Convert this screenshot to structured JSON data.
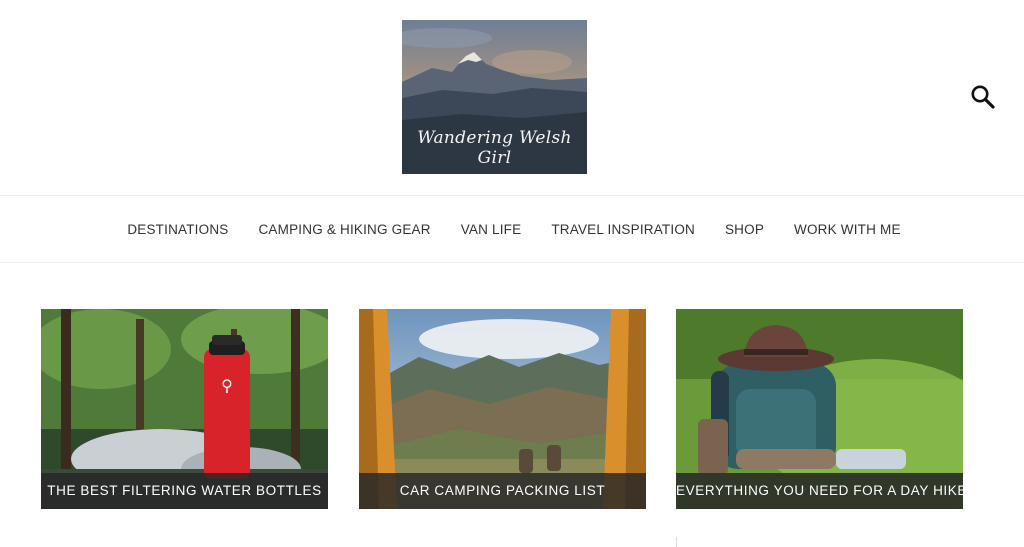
{
  "header": {
    "logo_text": "Wandering Welsh Girl",
    "search_icon": "search-icon"
  },
  "nav": {
    "items": [
      {
        "label": "DESTINATIONS"
      },
      {
        "label": "CAMPING & HIKING GEAR"
      },
      {
        "label": "VAN LIFE"
      },
      {
        "label": "TRAVEL INSPIRATION"
      },
      {
        "label": "SHOP"
      },
      {
        "label": "WORK WITH ME"
      }
    ]
  },
  "cards": [
    {
      "title": "THE BEST FILTERING WATER BOTTLES"
    },
    {
      "title": "CAR CAMPING PACKING LIST"
    },
    {
      "title": "EVERYTHING YOU NEED FOR A DAY HIKE"
    }
  ],
  "colors": {
    "caption_bg": "#262628",
    "nav_text": "#333333",
    "border": "#ececec"
  }
}
